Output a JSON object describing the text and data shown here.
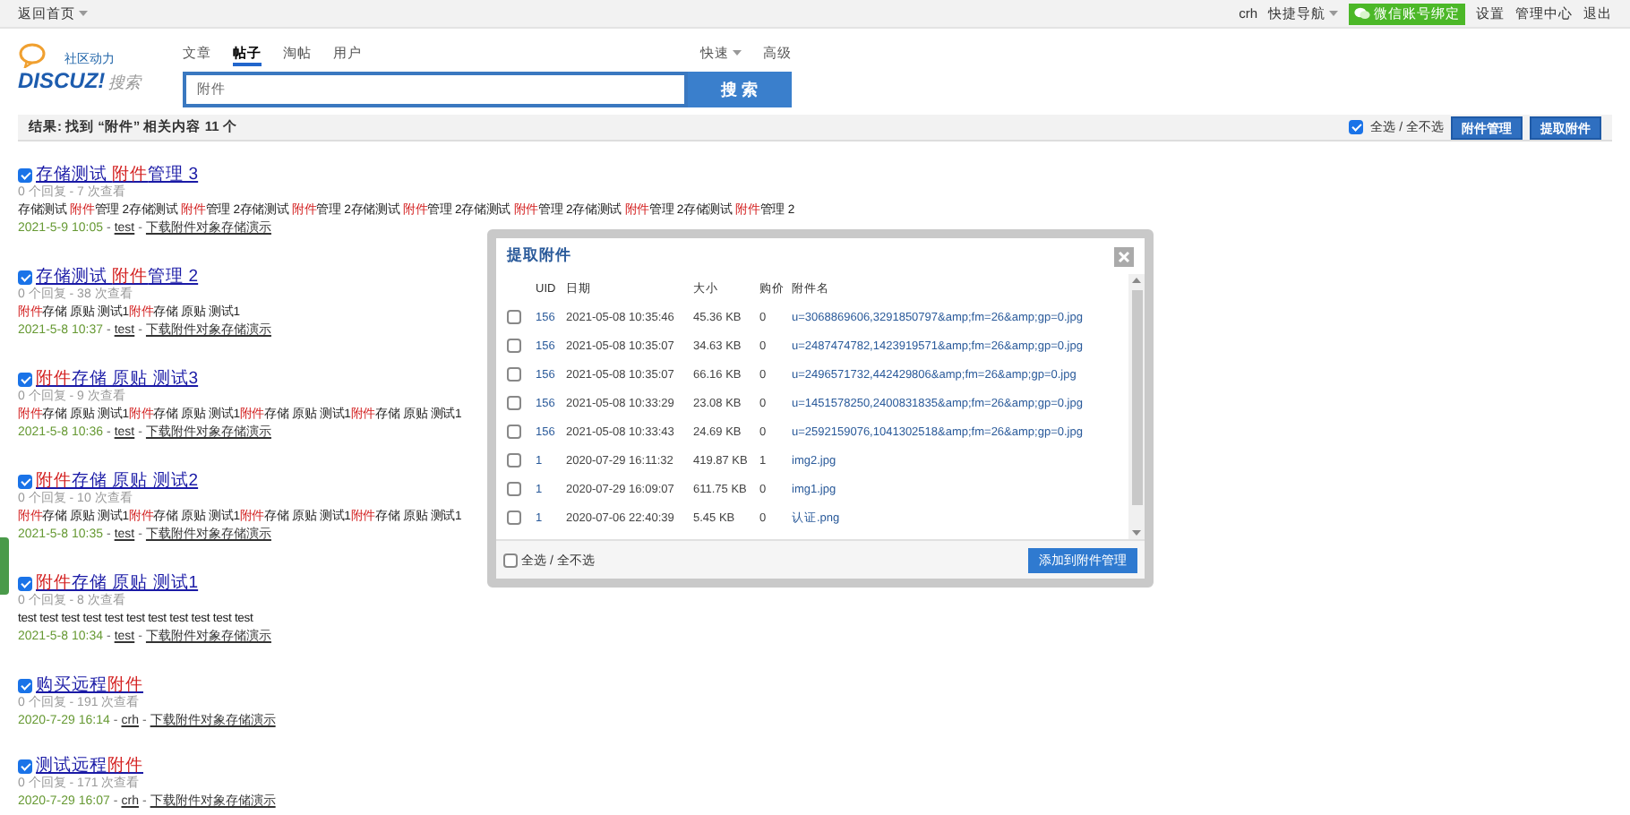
{
  "topbar": {
    "home": "返回首页",
    "user": "crh",
    "quicknav": "快捷导航",
    "wechat": "微信账号绑定",
    "links": [
      "设置",
      "管理中心",
      "退出"
    ]
  },
  "logo": {
    "tagline": "社区动力",
    "brand": "DISCUZ!",
    "suffix": "搜索"
  },
  "search_tabs": [
    {
      "label": "文章",
      "selected": false
    },
    {
      "label": "帖子",
      "selected": true
    },
    {
      "label": "淘帖",
      "selected": false
    },
    {
      "label": "用户",
      "selected": false
    }
  ],
  "search_links": [
    "快速",
    "高级"
  ],
  "search": {
    "value": "附件",
    "button": "搜 索"
  },
  "results_bar": {
    "summary": "结果: 找到 “附件” 相关内容 11 个",
    "select_all": "全选 / 全不选",
    "select_all_checked": true,
    "buttons": [
      "附件管理",
      "提取附件"
    ]
  },
  "results": [
    {
      "checked": true,
      "title": [
        {
          "t": "存储测试 "
        },
        {
          "t": "附件",
          "hl": true
        },
        {
          "t": "管理 3"
        }
      ],
      "stats": "0 个回复 - 7 次查看",
      "snippet": [
        {
          "t": "存储测试 "
        },
        {
          "t": "附件",
          "hl": true
        },
        {
          "t": "管理 2存储测试 "
        },
        {
          "t": "附件",
          "hl": true
        },
        {
          "t": "管理 2存储测试 "
        },
        {
          "t": "附件",
          "hl": true
        },
        {
          "t": "管理 2存储测试 "
        },
        {
          "t": "附件",
          "hl": true
        },
        {
          "t": "管理 2存储测试 "
        },
        {
          "t": "附件",
          "hl": true
        },
        {
          "t": "管理 2存储测试 "
        },
        {
          "t": "附件",
          "hl": true
        },
        {
          "t": "管理 2存储测试 "
        },
        {
          "t": "附件",
          "hl": true
        },
        {
          "t": "管理 2"
        }
      ],
      "date": "2021-5-9 10:05",
      "sep1": "-",
      "author": "test",
      "sep2": "-",
      "forum": "下载附件对象存储演示"
    },
    {
      "checked": true,
      "title": [
        {
          "t": "存储测试 "
        },
        {
          "t": "附件",
          "hl": true
        },
        {
          "t": "管理 2"
        }
      ],
      "stats": "0 个回复 - 38 次查看",
      "snippet": [
        {
          "t": "附件",
          "hl": true
        },
        {
          "t": "存储 原贴 测试1"
        },
        {
          "t": "附件",
          "hl": true
        },
        {
          "t": "存储 原贴 测试1"
        }
      ],
      "date": "2021-5-8 10:37",
      "sep1": "-",
      "author": "test",
      "sep2": "-",
      "forum": "下载附件对象存储演示"
    },
    {
      "checked": true,
      "title": [
        {
          "t": "附件",
          "hl": true
        },
        {
          "t": "存储 原贴 测试3"
        }
      ],
      "stats": "0 个回复 - 9 次查看",
      "snippet": [
        {
          "t": "附件",
          "hl": true
        },
        {
          "t": "存储 原贴 测试1"
        },
        {
          "t": "附件",
          "hl": true
        },
        {
          "t": "存储 原贴 测试1"
        },
        {
          "t": "附件",
          "hl": true
        },
        {
          "t": "存储 原贴 测试1"
        },
        {
          "t": "附件",
          "hl": true
        },
        {
          "t": "存储 原贴 测试1"
        }
      ],
      "date": "2021-5-8 10:36",
      "sep1": "-",
      "author": "test",
      "sep2": "-",
      "forum": "下载附件对象存储演示"
    },
    {
      "checked": true,
      "title": [
        {
          "t": "附件",
          "hl": true
        },
        {
          "t": "存储 原贴 测试2"
        }
      ],
      "stats": "0 个回复 - 10 次查看",
      "snippet": [
        {
          "t": "附件",
          "hl": true
        },
        {
          "t": "存储 原贴 测试1"
        },
        {
          "t": "附件",
          "hl": true
        },
        {
          "t": "存储 原贴 测试1"
        },
        {
          "t": "附件",
          "hl": true
        },
        {
          "t": "存储 原贴 测试1"
        },
        {
          "t": "附件",
          "hl": true
        },
        {
          "t": "存储 原贴 测试1"
        }
      ],
      "date": "2021-5-8 10:35",
      "sep1": "-",
      "author": "test",
      "sep2": "-",
      "forum": "下载附件对象存储演示"
    },
    {
      "checked": true,
      "title": [
        {
          "t": "附件",
          "hl": true
        },
        {
          "t": "存储 原贴 测试1"
        }
      ],
      "stats": "0 个回复 - 8 次查看",
      "snippet": [
        {
          "t": "test test test test test test test test test test test"
        }
      ],
      "date": "2021-5-8 10:34",
      "sep1": "-",
      "author": "test",
      "sep2": "-",
      "forum": "下载附件对象存储演示"
    },
    {
      "checked": true,
      "title": [
        {
          "t": "购买远程"
        },
        {
          "t": "附件",
          "hl": true
        }
      ],
      "stats": "0 个回复 - 191 次查看",
      "date": "2020-7-29 16:14",
      "sep1": "-",
      "author": "crh",
      "sep2": "-",
      "forum": "下载附件对象存储演示"
    },
    {
      "checked": true,
      "title": [
        {
          "t": "测试远程"
        },
        {
          "t": "附件",
          "hl": true
        }
      ],
      "stats": "0 个回复 - 171 次查看",
      "date": "2020-7-29 16:07",
      "sep1": "-",
      "author": "crh",
      "sep2": "-",
      "forum": "下载附件对象存储演示"
    }
  ],
  "dialog": {
    "title": "提取附件",
    "columns": [
      "UID",
      "日期",
      "大小",
      "购价",
      "附件名"
    ],
    "rows": [
      {
        "checked": false,
        "uid": "156",
        "date": "2021-05-08 10:35:46",
        "size": "45.36 KB",
        "price": "0",
        "name": "u=3068869606,3291850797&amp;fm=26&amp;gp=0.jpg"
      },
      {
        "checked": false,
        "uid": "156",
        "date": "2021-05-08 10:35:07",
        "size": "34.63 KB",
        "price": "0",
        "name": "u=2487474782,1423919571&amp;fm=26&amp;gp=0.jpg"
      },
      {
        "checked": false,
        "uid": "156",
        "date": "2021-05-08 10:35:07",
        "size": "66.16 KB",
        "price": "0",
        "name": "u=2496571732,442429806&amp;fm=26&amp;gp=0.jpg"
      },
      {
        "checked": false,
        "uid": "156",
        "date": "2021-05-08 10:33:29",
        "size": "23.08 KB",
        "price": "0",
        "name": "u=1451578250,2400831835&amp;fm=26&amp;gp=0.jpg"
      },
      {
        "checked": false,
        "uid": "156",
        "date": "2021-05-08 10:33:43",
        "size": "24.69 KB",
        "price": "0",
        "name": "u=2592159076,1041302518&amp;fm=26&amp;gp=0.jpg"
      },
      {
        "checked": false,
        "uid": "1",
        "date": "2020-07-29 16:11:32",
        "size": "419.87 KB",
        "price": "1",
        "name": "img2.jpg"
      },
      {
        "checked": false,
        "uid": "1",
        "date": "2020-07-29 16:09:07",
        "size": "611.75 KB",
        "price": "0",
        "name": "img1.jpg"
      },
      {
        "checked": false,
        "uid": "1",
        "date": "2020-07-06 22:40:39",
        "size": "5.45 KB",
        "price": "0",
        "name": "认证.png"
      }
    ],
    "select_all": "全选 / 全不选",
    "select_all_checked": false,
    "button": "添加到附件管理"
  }
}
